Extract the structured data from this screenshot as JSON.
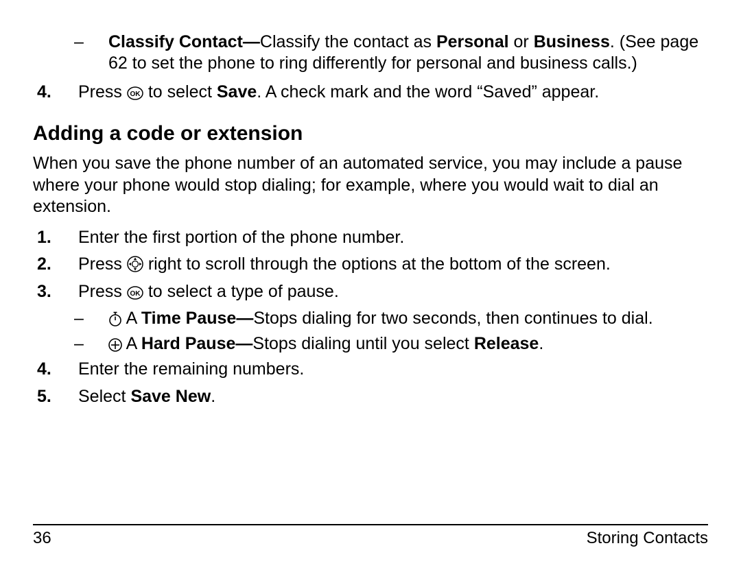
{
  "top": {
    "classify_bold": "Classify Contact—",
    "classify_pre": "Classify the contact as ",
    "classify_personal": "Personal",
    "classify_mid": " or ",
    "classify_business": "Business",
    "classify_period": ".",
    "classify_tail": "(See page 62 to set the phone to ring differently for personal and business calls.)"
  },
  "step4_top": {
    "num": "4.",
    "pre": "Press ",
    "mid": " to select ",
    "save": "Save",
    "tail": ". A check mark and the word “Saved” appear."
  },
  "heading": "Adding a code or extension",
  "intro": "When you save the phone number of an automated service, you may include a pause where your phone would stop dialing; for example, where you would wait to dial an extension.",
  "s1": {
    "num": "1.",
    "text": "Enter the first portion of the phone number."
  },
  "s2": {
    "num": "2.",
    "pre": "Press ",
    "tail": " right to scroll through the options at the bottom of the screen."
  },
  "s3": {
    "num": "3.",
    "pre": "Press ",
    "tail": " to select a type of pause."
  },
  "s3a": {
    "dash": "–",
    "pre": " A ",
    "bold": "Time Pause—",
    "tail": "Stops dialing for two seconds, then continues to dial."
  },
  "s3b": {
    "dash": "–",
    "pre": " A ",
    "bold": "Hard Pause—",
    "mid": "Stops dialing until you select ",
    "rel": "Release",
    "tail": "."
  },
  "s4": {
    "num": "4.",
    "text": "Enter the remaining numbers."
  },
  "s5": {
    "num": "5.",
    "pre": "Select ",
    "bold": "Save New",
    "tail": "."
  },
  "dash": "–",
  "footer": {
    "page": "36",
    "section": "Storing Contacts"
  }
}
